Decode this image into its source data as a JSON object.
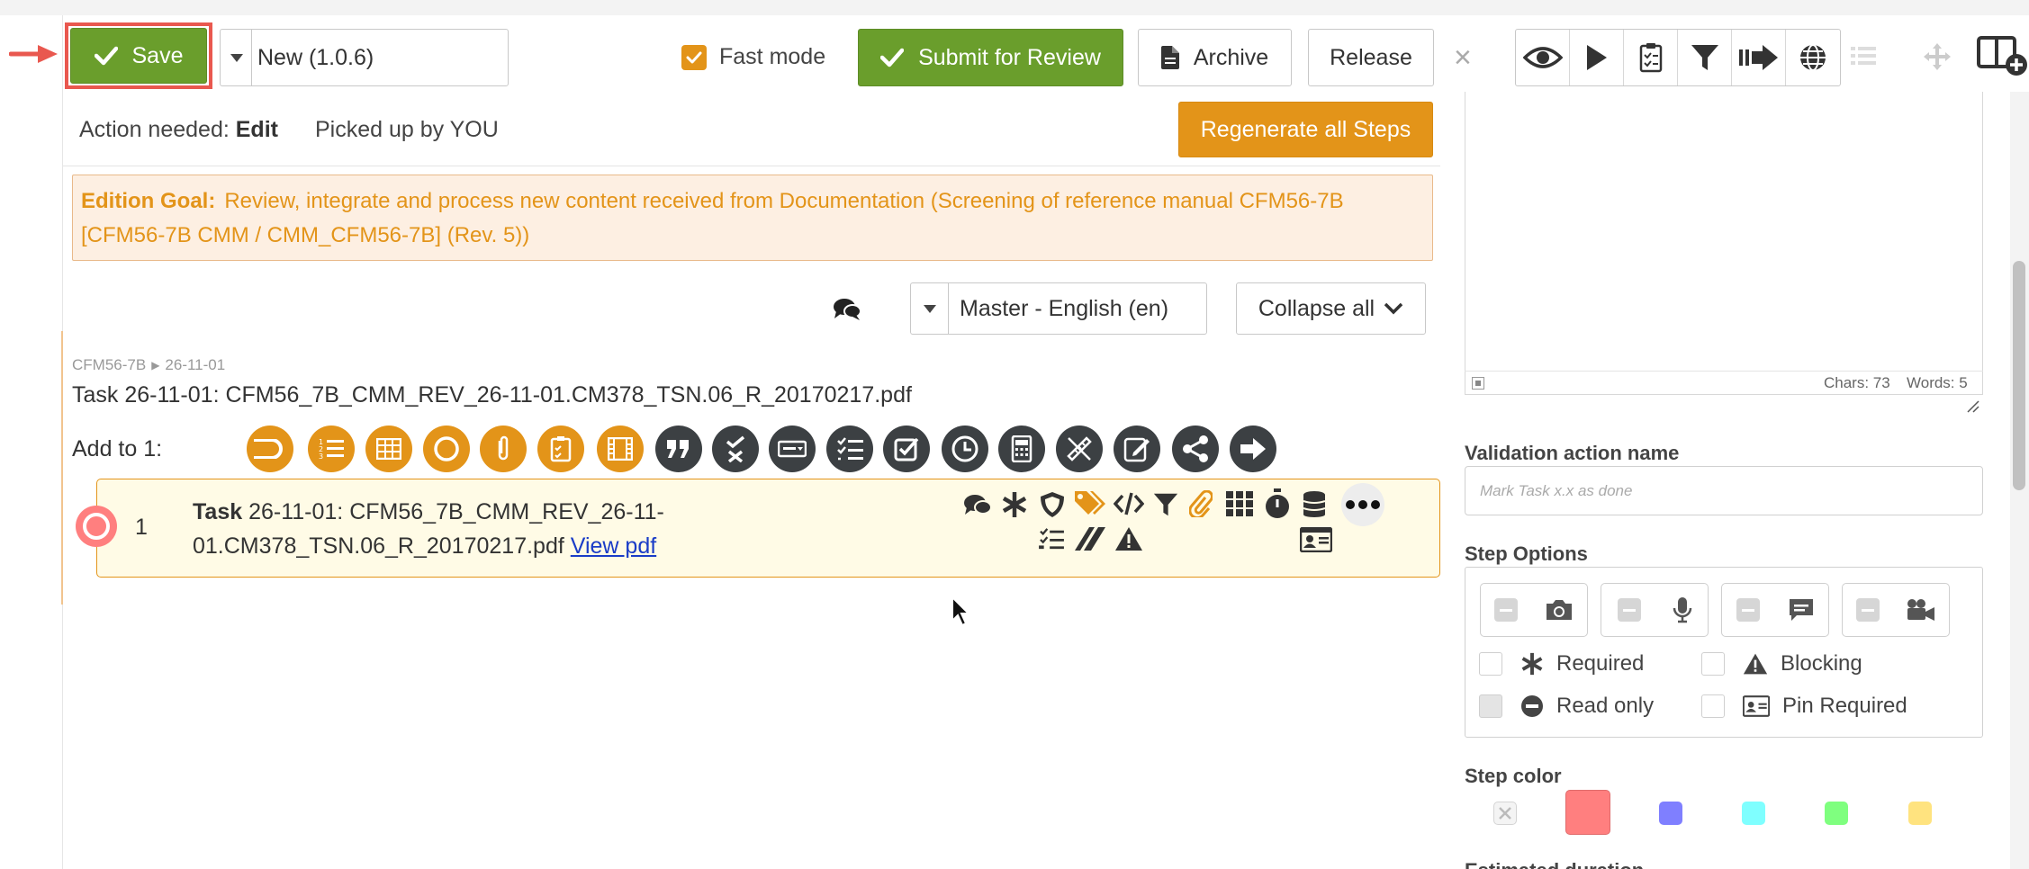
{
  "toolbar": {
    "save_label": "Save",
    "version_value": "New (1.0.6)",
    "fast_mode_label": "Fast mode",
    "fast_mode_checked": true,
    "submit_label": "Submit for Review",
    "archive_label": "Archive",
    "release_label": "Release",
    "close_symbol": "×",
    "right_tools": [
      "eye-icon",
      "play-icon",
      "clipboard-check-icon",
      "filter-icon",
      "arrow-forward-bars-icon",
      "globe-icon",
      "list-icon",
      "move-icon",
      "add-panel-icon"
    ]
  },
  "status": {
    "action_prefix": "Action needed:",
    "action_value": "Edit",
    "picked_up": "Picked up by YOU",
    "regenerate_label": "Regenerate all Steps"
  },
  "goal": {
    "label": "Edition Goal:",
    "text": "Review, integrate and process new content received from Documentation (Screening of reference manual CFM56-7B [CFM56-7B CMM / CMM_CFM56-7B] (Rev. 5))"
  },
  "controls": {
    "language": "Master - English (en)",
    "collapse_label": "Collapse all"
  },
  "breadcrumb": {
    "root": "CFM56-7B",
    "separator": "▶",
    "leaf": "26-11-01"
  },
  "task": {
    "title": "Task 26-11-01: CFM56_7B_CMM_REV_26-11-01.CM378_TSN.06_R_20170217.pdf",
    "add_to_label": "Add to 1:"
  },
  "step": {
    "number": "1",
    "kind": "Task",
    "text": "26-11-01: CFM56_7B_CMM_REV_26-11-01.CM378_TSN.06_R_20170217.pdf",
    "link_label": "View pdf"
  },
  "right_panel": {
    "chars_label": "Chars: 73",
    "words_label": "Words: 5",
    "validation_title": "Validation action name",
    "validation_placeholder": "Mark Task x.x as done",
    "step_options_title": "Step Options",
    "opt_required": "Required",
    "opt_blocking": "Blocking",
    "opt_read_only": "Read only",
    "opt_pin_required": "Pin Required",
    "step_color_title": "Step color",
    "step_colors": [
      "none",
      "#ff7f7f",
      "#7f7fff",
      "#7fffff",
      "#7fff7f",
      "#ffe37f"
    ],
    "selected_color": "#ff7f7f",
    "next_section_title": "Estimated duration"
  },
  "colors": {
    "accent_green": "#6a9e2c",
    "accent_orange": "#e39419",
    "highlight_red": "#e9584f",
    "dark_icon": "#3c4043"
  }
}
